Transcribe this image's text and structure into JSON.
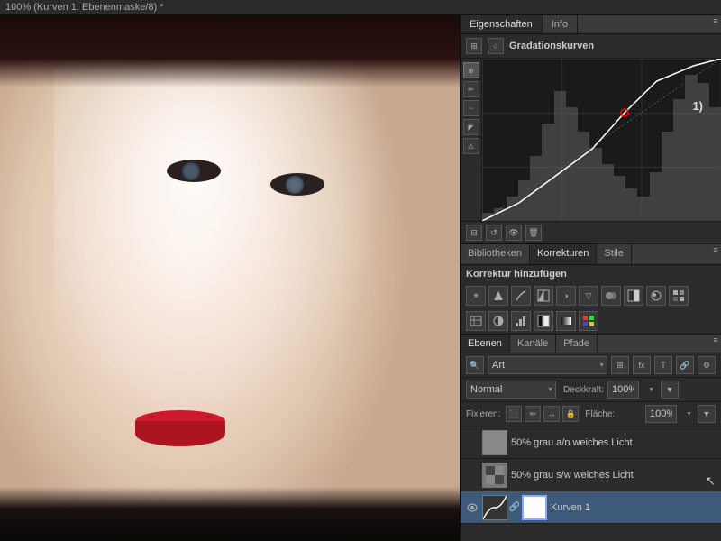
{
  "titleBar": {
    "text": "100% (Kurven 1, Ebenenmaske/8) *"
  },
  "propertiesPanel": {
    "tabs": [
      {
        "label": "Eigenschaften",
        "active": true
      },
      {
        "label": "Info",
        "active": false
      }
    ],
    "curvesTitle": "Gradationskurven",
    "headerIcons": [
      "⊞",
      "○"
    ],
    "tools": [
      "⊕",
      "↗",
      "~",
      "⊠",
      "⚠"
    ],
    "bottomIcons": [
      "⊟",
      "↺",
      "👁",
      "🗑"
    ],
    "curveAnnotation": "1)"
  },
  "correctionsPanel": {
    "tabs": [
      {
        "label": "Bibliotheken",
        "active": false
      },
      {
        "label": "Korrekturen",
        "active": true
      },
      {
        "label": "Stile",
        "active": false
      }
    ],
    "title": "Korrektur hinzufügen",
    "icons": [
      "☀",
      "⬛",
      "📋",
      "🔲",
      "◑",
      "▽",
      "🎨",
      "📊",
      "🔧",
      "🔲",
      "🔲",
      "🔲",
      "🖼",
      "🔲",
      "📋",
      "🔲",
      "🔲",
      "🔲"
    ]
  },
  "layersPanel": {
    "tabs": [
      {
        "label": "Ebenen",
        "active": true
      },
      {
        "label": "Kanäle",
        "active": false
      },
      {
        "label": "Pfade",
        "active": false
      }
    ],
    "filterLabel": "Art",
    "filterIcons": [
      "🔍",
      "🔲",
      "T",
      "🔗",
      "🔧"
    ],
    "blendMode": "Normal",
    "opacityLabel": "Deckkraft:",
    "opacityValue": "100%",
    "fillLabel": "Fläche:",
    "fillValue": "100%",
    "lockLabel": "Fixieren:",
    "lockIcons": [
      "⬛",
      "✏",
      "↔",
      "🔒"
    ],
    "layers": [
      {
        "id": "layer1",
        "visible": false,
        "thumbColor": "#888",
        "name": "50% grau a/n weiches Licht",
        "hasChain": false,
        "active": false
      },
      {
        "id": "layer2",
        "visible": false,
        "thumbColor": "#777",
        "name": "50% grau s/w weiches Licht",
        "hasChain": false,
        "active": false,
        "hasCursor": true
      },
      {
        "id": "layer3",
        "visible": true,
        "thumbColor": "#222",
        "maskColor": "#fff",
        "name": "Kurven 1",
        "hasChain": true,
        "active": true
      }
    ]
  }
}
